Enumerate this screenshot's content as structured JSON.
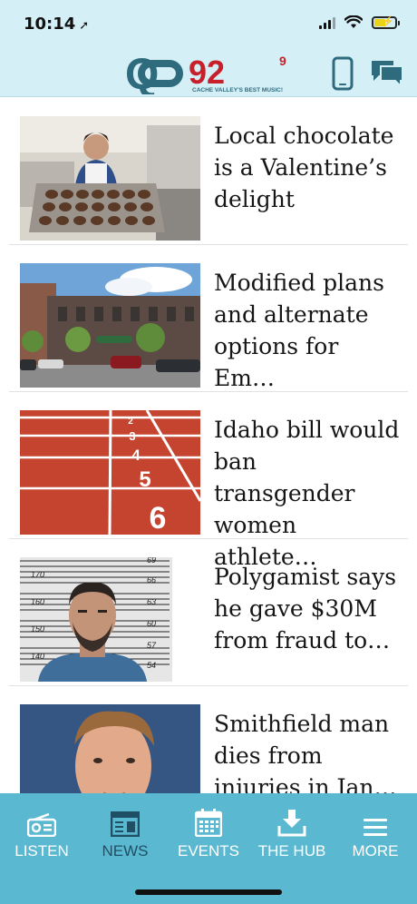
{
  "status": {
    "time": "10:14"
  },
  "header": {
    "logo_q": "Q",
    "logo_number": "92",
    "logo_super": "9",
    "logo_tagline": "CACHE VALLEY'S BEST MUSIC!",
    "icons": [
      "phone-icon",
      "chat-icon"
    ]
  },
  "articles": [
    {
      "title": "Local chocolate is a Valentine’s delight",
      "image": "baker-with-chocolate-tray"
    },
    {
      "title": "Modified plans and alternate options for Em…",
      "image": "downtown-building"
    },
    {
      "title": "Idaho bill would ban transgender women athlete…",
      "image": "running-track-lanes"
    },
    {
      "title": "Polygamist says he gave $30M from fraud to…",
      "image": "mugshot"
    },
    {
      "title": "Smithfield man dies from injuries in Jan…",
      "image": "portrait"
    }
  ],
  "track_numbers": [
    "2",
    "3",
    "4",
    "5",
    "6"
  ],
  "mugshot_scale": [
    "170",
    "160",
    "150",
    "140",
    "69",
    "66",
    "63",
    "60",
    "57",
    "54"
  ],
  "nav": [
    {
      "label": "LISTEN",
      "icon": "radio-icon",
      "active": false
    },
    {
      "label": "NEWS",
      "icon": "newspaper-icon",
      "active": true
    },
    {
      "label": "EVENTS",
      "icon": "calendar-icon",
      "active": false
    },
    {
      "label": "THE HUB",
      "icon": "download-icon",
      "active": false
    },
    {
      "label": "MORE",
      "icon": "menu-icon",
      "active": false
    }
  ],
  "colors": {
    "header_bg": "#d5eff7",
    "nav_bg": "#5bb8d1",
    "nav_active": "#1f4f65",
    "logo_teal": "#2e6b7d",
    "logo_red": "#c8202a"
  }
}
